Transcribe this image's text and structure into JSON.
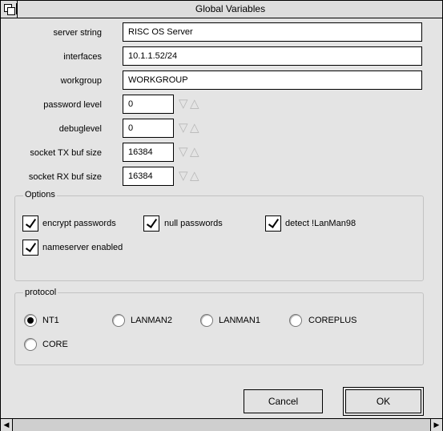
{
  "window": {
    "title": "Global Variables"
  },
  "fields": [
    {
      "label": "server string",
      "value": "RISC OS Server"
    },
    {
      "label": "interfaces",
      "value": "10.1.1.52/24"
    },
    {
      "label": "workgroup",
      "value": "WORKGROUP"
    }
  ],
  "numeric_fields": [
    {
      "label": "password level",
      "value": "0"
    },
    {
      "label": "debuglevel",
      "value": "0"
    },
    {
      "label": "socket TX buf size",
      "value": "16384"
    },
    {
      "label": "socket RX buf size",
      "value": "16384"
    }
  ],
  "options": {
    "title": "Options",
    "items": [
      {
        "label": "encrypt passwords",
        "checked": true
      },
      {
        "label": "null passwords",
        "checked": true
      },
      {
        "label": "detect !LanMan98",
        "checked": true
      },
      {
        "label": "nameserver enabled",
        "checked": true
      }
    ]
  },
  "protocol": {
    "title": "protocol",
    "items": [
      {
        "label": "NT1",
        "selected": true
      },
      {
        "label": "LANMAN2",
        "selected": false
      },
      {
        "label": "LANMAN1",
        "selected": false
      },
      {
        "label": "COREPLUS",
        "selected": false
      },
      {
        "label": "CORE",
        "selected": false
      }
    ]
  },
  "buttons": {
    "cancel": "Cancel",
    "ok": "OK"
  },
  "arrows": {
    "down": "▽",
    "up": "△"
  }
}
